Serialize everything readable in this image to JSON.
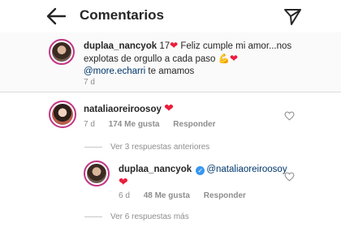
{
  "header": {
    "title": "Comentarios"
  },
  "caption": {
    "username": "duplaa_nancyok",
    "text_before": " 17",
    "text_middle": " Feliz cumple mi amor...nos explotas de orgullo a cada paso",
    "mention": "@more.echarri",
    "text_after": " te amamos",
    "time": "7 d"
  },
  "comment": {
    "username": "nataliaoreiroosoy",
    "time": "7 d",
    "likes": "174 Me gusta",
    "reply_label": "Responder"
  },
  "view_previous": "Ver 3 respuestas anteriores",
  "reply": {
    "username": "duplaa_nancyok",
    "mention": "@nataliaoreiroosoy",
    "time": "6 d",
    "likes": "48 Me gusta",
    "reply_label": "Responder"
  },
  "view_more": "Ver 6 respuestas más",
  "colors": {
    "heart": "#ed1c3c",
    "mention": "#00376b",
    "verified": "#3897f0",
    "meta": "#8e8e8e"
  },
  "icons": [
    "back-arrow-icon",
    "direct-send-icon",
    "heart-icon",
    "like-heart-outline-icon",
    "verified-badge-icon",
    "flexed-biceps-emoji"
  ]
}
